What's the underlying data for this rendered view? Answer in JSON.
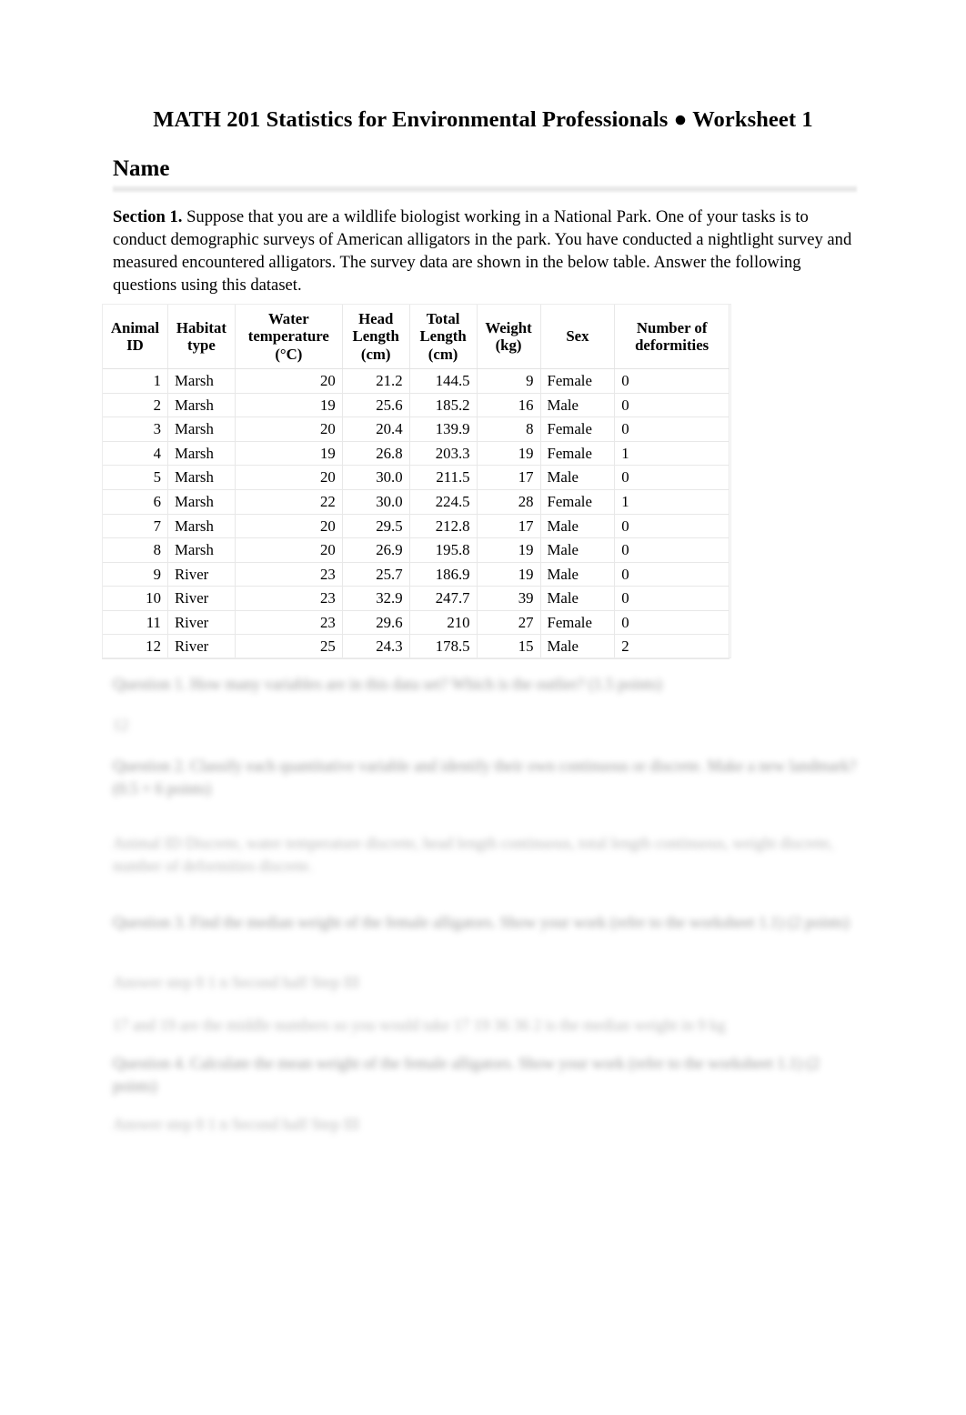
{
  "document": {
    "title": "MATH 201 Statistics for Environmental Professionals ● Worksheet 1",
    "name_heading": "Name"
  },
  "section1": {
    "label": "Section 1.",
    "body": " Suppose that you are a wildlife biologist working in a National Park. One of your tasks is to conduct demographic surveys of American alligators in the park. You have conducted a nightlight survey and measured encountered alligators. The survey data are shown in the below table. Answer the following questions using this dataset."
  },
  "table": {
    "headers": [
      "Animal ID",
      "Habitat type",
      "Water temperature (°C)",
      "Head Length (cm)",
      "Total Length (cm)",
      "Weight (kg)",
      "Sex",
      "Number of deformities"
    ],
    "headers_lines": [
      [
        "Animal",
        "ID"
      ],
      [
        "Habitat",
        "type"
      ],
      [
        "Water",
        "temperature",
        "(°C)"
      ],
      [
        "Head",
        "Length",
        "(cm)"
      ],
      [
        "Total",
        "Length",
        "(cm)"
      ],
      [
        "Weight",
        "(kg)"
      ],
      [
        "Sex"
      ],
      [
        "Number of",
        "deformities"
      ]
    ],
    "rows": [
      {
        "id": "1",
        "habitat": "Marsh",
        "water_temp": "20",
        "head_length": "21.2",
        "total_length": "144.5",
        "weight": "9",
        "sex": "Female",
        "deformities": "0"
      },
      {
        "id": "2",
        "habitat": "Marsh",
        "water_temp": "19",
        "head_length": "25.6",
        "total_length": "185.2",
        "weight": "16",
        "sex": "Male",
        "deformities": "0"
      },
      {
        "id": "3",
        "habitat": "Marsh",
        "water_temp": "20",
        "head_length": "20.4",
        "total_length": "139.9",
        "weight": "8",
        "sex": "Female",
        "deformities": "0"
      },
      {
        "id": "4",
        "habitat": "Marsh",
        "water_temp": "19",
        "head_length": "26.8",
        "total_length": "203.3",
        "weight": "19",
        "sex": "Female",
        "deformities": "1"
      },
      {
        "id": "5",
        "habitat": "Marsh",
        "water_temp": "20",
        "head_length": "30.0",
        "total_length": "211.5",
        "weight": "17",
        "sex": "Male",
        "deformities": "0"
      },
      {
        "id": "6",
        "habitat": "Marsh",
        "water_temp": "22",
        "head_length": "30.0",
        "total_length": "224.5",
        "weight": "28",
        "sex": "Female",
        "deformities": "1"
      },
      {
        "id": "7",
        "habitat": "Marsh",
        "water_temp": "20",
        "head_length": "29.5",
        "total_length": "212.8",
        "weight": "17",
        "sex": "Male",
        "deformities": "0"
      },
      {
        "id": "8",
        "habitat": "Marsh",
        "water_temp": "20",
        "head_length": "26.9",
        "total_length": "195.8",
        "weight": "19",
        "sex": "Male",
        "deformities": "0"
      },
      {
        "id": "9",
        "habitat": "River",
        "water_temp": "23",
        "head_length": "25.7",
        "total_length": "186.9",
        "weight": "19",
        "sex": "Male",
        "deformities": "0"
      },
      {
        "id": "10",
        "habitat": "River",
        "water_temp": "23",
        "head_length": "32.9",
        "total_length": "247.7",
        "weight": "39",
        "sex": "Male",
        "deformities": "0"
      },
      {
        "id": "11",
        "habitat": "River",
        "water_temp": "23",
        "head_length": "29.6",
        "total_length": "210",
        "weight": "27",
        "sex": "Female",
        "deformities": "0"
      },
      {
        "id": "12",
        "habitat": "River",
        "water_temp": "25",
        "head_length": "24.3",
        "total_length": "178.5",
        "weight": "15",
        "sex": "Male",
        "deformities": "2"
      }
    ]
  },
  "redacted": {
    "note": "Question text below the table is blurred and illegible in the source image.",
    "blocks": [
      {
        "text": "Question 1. How many variables are in this data set? Which is the outlier? (1.5 points)"
      },
      {
        "text": "12"
      },
      {
        "text": "Question 2. Classify each quantitative variable and identify their own continuous or discrete. Make a new landmark? (0.5 × 6 points)"
      },
      {
        "text": "Animal ID Discrete, water temperature discrete, head length continuous, total length continuous, weight discrete, number of deformities discrete."
      },
      {
        "text": "Question 3. Find the median weight of the female alligators. Show your work (refer to the worksheet 1.1) (2 points)"
      },
      {
        "text": "Answer step 0 1 n Second half Step III"
      },
      {
        "text": "17 and 19 are the middle numbers so you would take 17 19 36 36 2 is the median weight in 9 kg"
      },
      {
        "text": "Question 4. Calculate the mean weight of the female alligators. Show your work (refer to the worksheet 1.1) (2 points)"
      },
      {
        "text": "Answer step 0 1 n Second half Step III"
      }
    ]
  }
}
